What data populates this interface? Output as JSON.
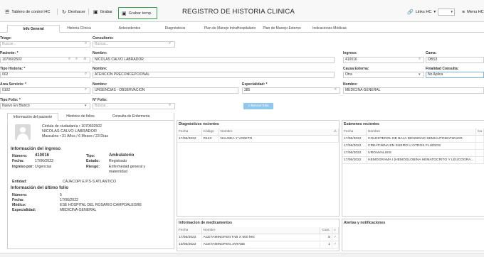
{
  "toolbar": {
    "dashboard_label": "Tablero de control HC",
    "undo_label": "Deshacer",
    "save_label": "Grabar",
    "save_temp_label": "Grabar temp.",
    "title": "REGISTRO DE HISTORIA CLINICA",
    "links_label": "Links HC",
    "menu_label": "Menu HC"
  },
  "tabs": [
    "Info General",
    "Historia Clínica",
    "Antecedentes",
    "Diagnósticos",
    "Plan de Manejo IntraHospitalario",
    "Plan de Manejo Externo",
    "Indicaciones Médicas"
  ],
  "form": {
    "triage_label": "Triage:",
    "triage_placeholder": "Buscar...",
    "consultorio_label": "Consultorio:",
    "consultorio_placeholder": "Buscar...",
    "paciente_label": "Paciente: *",
    "paciente_value": "1070602502",
    "nombre_paciente_label": "Nombre:",
    "nombre_paciente_value": "NICOLAS  CALVO LABRADOR",
    "ingreso_label": "Ingreso:",
    "ingreso_value": "410016",
    "cama_label": "Cama:",
    "cama_value": "OBS3",
    "tipo_historia_label": "Tipo Historia: *",
    "tipo_historia_value": "002",
    "nombre_historia_label": "Nombre:",
    "nombre_historia_value": "ATENCION PRECONCEPCIONAL",
    "causa_externa_label": "Causa Externa:",
    "causa_externa_value": "Otra",
    "finalidad_label": "Finalidad Consulta:",
    "finalidad_value": "No Aplica",
    "area_servicio_label": "Area Servicio: *",
    "area_servicio_value": "0102",
    "nombre_area_label": "Nombre:",
    "nombre_area_value": "URGENCIAS - OBSERVACION",
    "especialidad_label": "Especialidad: *",
    "especialidad_value": "385",
    "nombre_especialidad_label": "Nombre:",
    "nombre_especialidad_value": "MEDICINA GENERAL",
    "tipo_folio_label": "Tipo Folio: *",
    "tipo_folio_value": "Nuevo En Blanco",
    "num_folio_label": "N° Folio:",
    "num_folio_placeholder": "Buscar...",
    "search_folio_button": "Buscar folio"
  },
  "patient_panel": {
    "tabs": [
      "Información del paciente",
      "Histórico de folios",
      "Consulta de Enfermeria"
    ],
    "id_line": "Cédula de ciudadanía  •  1070602502",
    "name": "NICOLAS CALVO LABRADOR",
    "details": "Masculino  •  31 Años / 6 Meses / 23 Días",
    "ingreso_section": "Información del ingreso",
    "numero_label": "Número:",
    "numero_value": "410016",
    "fecha_label": "Fecha:",
    "fecha_value": "17/06/2022",
    "ingreso_por_label": "Ingreso por:",
    "ingreso_por_value": "Urgencias",
    "tipo_label": "Tipo:",
    "tipo_value": "Ambulatorio",
    "estado_label": "Estado:",
    "estado_value": "Registrado",
    "riesgo_label": "Riesgo:",
    "riesgo_value": "Enfermedad general y maternidad",
    "entidad_label": "Entidad:",
    "entidad_value": "CAJACOPI E.P.S-S ATLANTICO",
    "folio_section": "Información del último folio",
    "folio_numero_label": "Número:",
    "folio_numero_value": "5",
    "folio_fecha_label": "Fecha:",
    "folio_fecha_value": "17/06/2022",
    "medico_label": "Médico:",
    "medico_value": "ESE HOSPITAL DEL ROSARIO CAMPOALEGRE",
    "folio_especialidad_label": "Especialidad:",
    "folio_especialidad_value": "MEDICINA GENERAL"
  },
  "diagnosticos": {
    "title": "Diagnósticos recientes",
    "columns": [
      "Fecha",
      "Código",
      "Nombre"
    ],
    "rows": [
      [
        "17/06/2022",
        "R11X",
        "NAUSEA Y VOMITO"
      ]
    ]
  },
  "examenes": {
    "title": "Exámenes recientes",
    "columns": [
      "Fecha",
      "Nombre",
      "Ca"
    ],
    "rows": [
      [
        "17/06/2022",
        "COLESTEROL DE BAJA DENSIDAD SEMIAUTOMATIZADO"
      ],
      [
        "17/06/2022",
        "CREATININA EN SUERO U OTROS FLUIDOS"
      ],
      [
        "17/06/2022",
        "UROANALISIS"
      ],
      [
        "17/06/2022",
        "HEMOGRAMA I (HEMOGLOBINA HEMATOCRITO Y LEUCOGRA..."
      ]
    ]
  },
  "medicamentos": {
    "title": "Informacion de medicamentos",
    "columns": [
      "Fecha",
      "Nombre",
      "Cant."
    ],
    "rows": [
      [
        "17/06/2022",
        "ACETAMINOFEN TAB X 500 MG",
        "5"
      ],
      [
        "10/06/2022",
        "ACETAMINOFEN JARABE",
        "1"
      ]
    ]
  },
  "alertas": {
    "title": "Alertas y notificaciones"
  },
  "icons": {
    "dashboard": "list-icon",
    "undo": "undo-icon",
    "save": "save-icon",
    "links": "link-icon",
    "menu": "hamburger-icon",
    "search": "search-icon",
    "check": "check-icon",
    "warning": "warning-icon",
    "home": "home-icon"
  },
  "colors": {
    "accent": "#2aa64a",
    "primary": "#8fc8ee",
    "check": "#2b87d6"
  }
}
